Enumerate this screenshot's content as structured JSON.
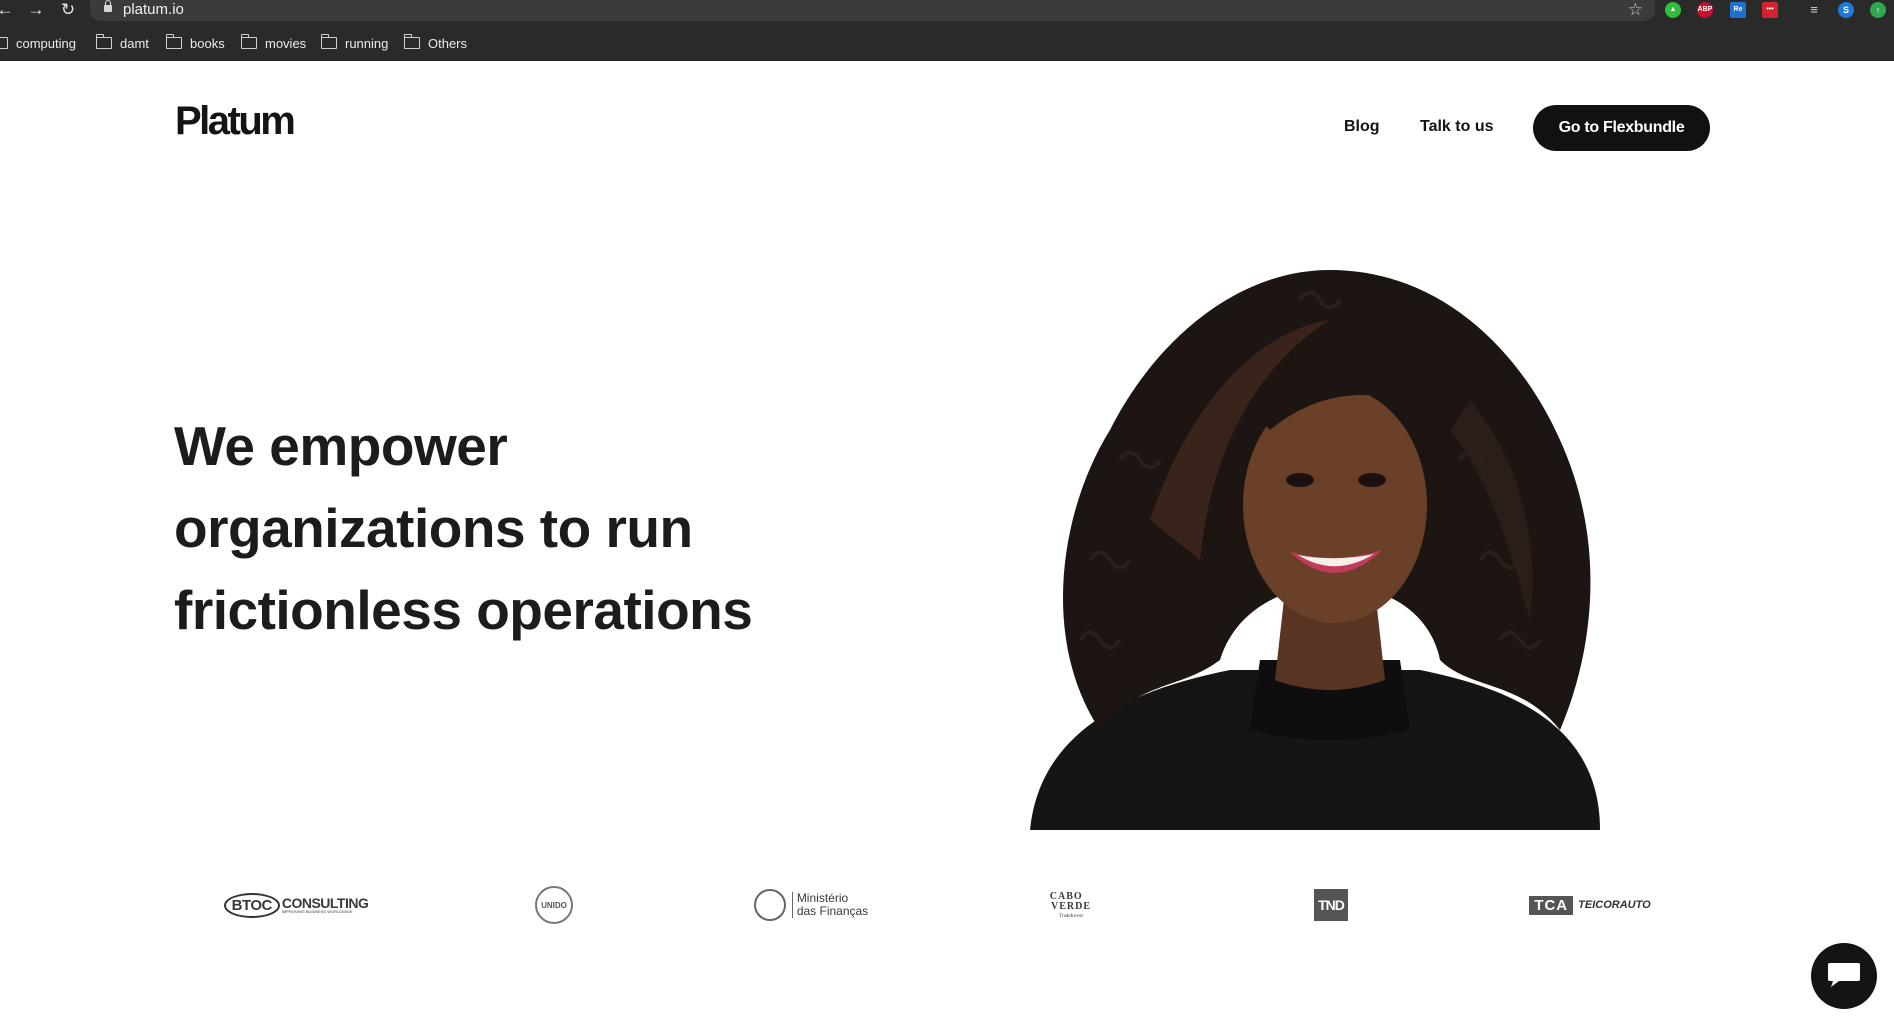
{
  "browser": {
    "url": "platum.io",
    "bookmarks": [
      "computing",
      "damt",
      "books",
      "movies",
      "running",
      "Others"
    ],
    "extension_icons": [
      "thumbs-up-icon",
      "adblock-plus-icon",
      "readability-icon",
      "lastpass-icon",
      "reading-list-icon",
      "profile-avatar-icon",
      "update-icon"
    ],
    "ext_labels": {
      "abp": "ABP",
      "re": "Re",
      "lp": "•••",
      "avatar": "S"
    }
  },
  "header": {
    "logo": "Platum",
    "nav": {
      "blog": "Blog",
      "talk": "Talk to us"
    },
    "cta": "Go to Flexbundle"
  },
  "hero": {
    "headline_lines": [
      "We empower",
      "organizations to run",
      "frictionless operations"
    ]
  },
  "clients": {
    "btoc": {
      "name": "BTOC",
      "suffix": "CONSULTING",
      "tagline": "IMPROVING BUSINESS WORLDWIDE"
    },
    "unido": {
      "name": "UNIDO"
    },
    "ministerio": {
      "line1": "Ministério",
      "line2": "das Finanças"
    },
    "cabo_verde": {
      "word1": "CABO",
      "word2": "VERDE",
      "sub": "TradeInvest"
    },
    "tnd": {
      "name": "TND"
    },
    "tca": {
      "mark": "TCA",
      "name": "TEICORAUTO"
    }
  },
  "colors": {
    "brand_dark": "#111111",
    "chrome_bg": "#2a2a2b",
    "page_bg": "#ffffff"
  }
}
